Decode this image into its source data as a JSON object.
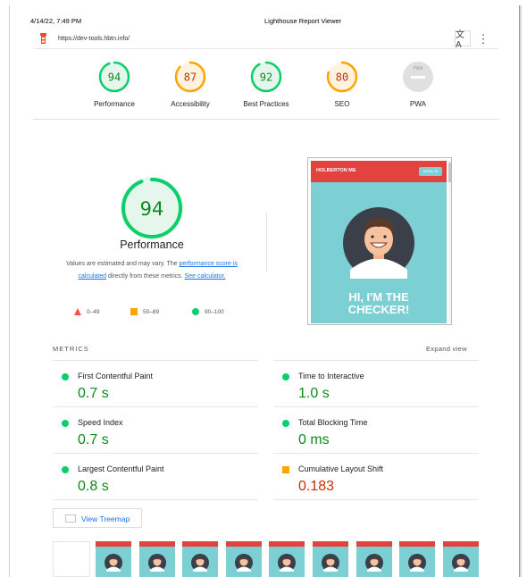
{
  "print_header": {
    "date": "4/14/22, 7:49 PM",
    "title": "Lighthouse Report Viewer"
  },
  "urlbar": {
    "url": "https://dev-tools.hbtn.info/"
  },
  "gauges": [
    {
      "label": "Performance",
      "score": "94",
      "status": "pass",
      "color": "#0cce6b"
    },
    {
      "label": "Accessibility",
      "score": "87",
      "status": "average",
      "color": "#ffa400"
    },
    {
      "label": "Best Practices",
      "score": "92",
      "status": "pass",
      "color": "#0cce6b"
    },
    {
      "label": "SEO",
      "score": "80",
      "status": "average",
      "color": "#ffa400"
    },
    {
      "label": "PWA",
      "score": "PWA",
      "status": "na",
      "color": "#cccccc"
    }
  ],
  "performance": {
    "score": "94",
    "title": "Performance",
    "desc_prefix": "Values are estimated and may vary. The ",
    "desc_link1": "performance score is calculated",
    "desc_mid": " directly from these metrics. ",
    "desc_link2": "See calculator."
  },
  "legend": [
    {
      "range": "0–49",
      "shape": "triangle",
      "color": "#ff4e42"
    },
    {
      "range": "50–89",
      "shape": "square",
      "color": "#ffa400"
    },
    {
      "range": "90–100",
      "shape": "circle",
      "color": "#0cce6b"
    }
  ],
  "screenshot": {
    "brand": "HOLBERTON ME",
    "menu": "MENU ☰",
    "headline_1": "HI, I'M THE",
    "headline_2": "CHECKER!"
  },
  "metrics": {
    "heading": "METRICS",
    "expand": "Expand view",
    "items": [
      {
        "name": "First Contentful Paint",
        "value": "0.7 s",
        "status": "pass"
      },
      {
        "name": "Time to Interactive",
        "value": "1.0 s",
        "status": "pass"
      },
      {
        "name": "Speed Index",
        "value": "0.7 s",
        "status": "pass"
      },
      {
        "name": "Total Blocking Time",
        "value": "0 ms",
        "status": "pass"
      },
      {
        "name": "Largest Contentful Paint",
        "value": "0.8 s",
        "status": "pass"
      },
      {
        "name": "Cumulative Layout Shift",
        "value": "0.183",
        "status": "average"
      }
    ]
  },
  "treemap": {
    "label": "View Treemap"
  },
  "colors": {
    "pass": "#0cce6b",
    "average": "#ffa400",
    "fail": "#ff4e42",
    "link": "#1a73e8",
    "brand_red": "#e2433f",
    "hero_teal": "#7ccfd2"
  }
}
